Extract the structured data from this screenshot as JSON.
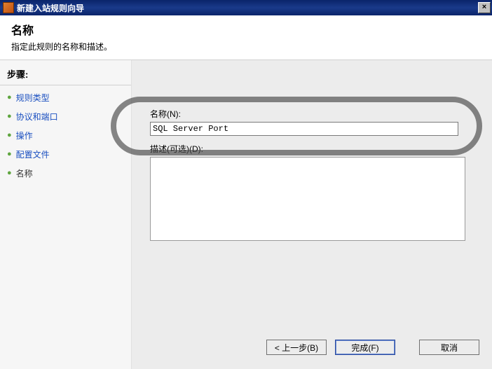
{
  "window": {
    "title": "新建入站规则向导"
  },
  "header": {
    "title": "名称",
    "subtitle": "指定此规则的名称和描述。"
  },
  "sidebar": {
    "steps_label": "步骤:",
    "items": [
      {
        "label": "规则类型",
        "current": false
      },
      {
        "label": "协议和端口",
        "current": false
      },
      {
        "label": "操作",
        "current": false
      },
      {
        "label": "配置文件",
        "current": false
      },
      {
        "label": "名称",
        "current": true
      }
    ]
  },
  "form": {
    "name_label": "名称(N):",
    "name_value": "SQL Server Port",
    "desc_label": "描述(可选)(D):",
    "desc_value": ""
  },
  "buttons": {
    "back": "< 上一步(B)",
    "finish": "完成(F)",
    "cancel": "取消"
  },
  "icons": {
    "close": "×"
  }
}
